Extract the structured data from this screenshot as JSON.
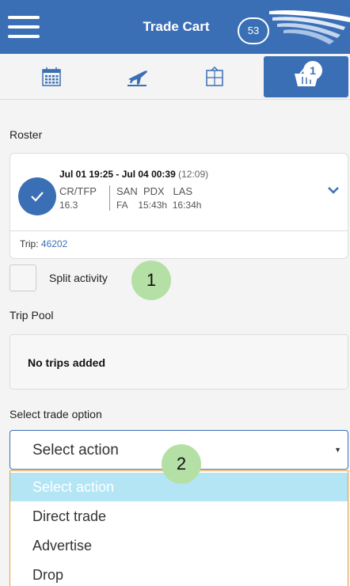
{
  "header": {
    "title": "Trade Cart",
    "badge_count": "53",
    "menu_icon": "hamburger-icon",
    "logo_icon": "airline-wing-logo"
  },
  "tabs": [
    {
      "icon": "calendar-icon"
    },
    {
      "icon": "airplane-icon"
    },
    {
      "icon": "hotel-icon"
    },
    {
      "icon": "basket-icon",
      "count": "1",
      "active": true
    }
  ],
  "roster": {
    "label": "Roster",
    "trip": {
      "dates": "Jul 01 19:25 - Jul 04 00:39",
      "duration": "(12:09)",
      "pairing": "CR/TFP",
      "value": "16.3",
      "stations": "SAN  PDX   LAS",
      "details": "FA    15:43h  16:34h",
      "trip_label": "Trip:",
      "trip_number": "46202"
    }
  },
  "split": {
    "label": "Split activity",
    "checked": false
  },
  "markers": {
    "one": "1",
    "two": "2"
  },
  "pool": {
    "label": "Trip Pool",
    "empty_text": "No trips added"
  },
  "trade": {
    "label": "Select trade option",
    "selected": "Select action",
    "options": [
      "Select action",
      "Direct trade",
      "Advertise",
      "Drop"
    ]
  },
  "colors": {
    "primary": "#3b6fb5",
    "marker": "#b5e0a5",
    "highlight": "#b3e5f5"
  }
}
